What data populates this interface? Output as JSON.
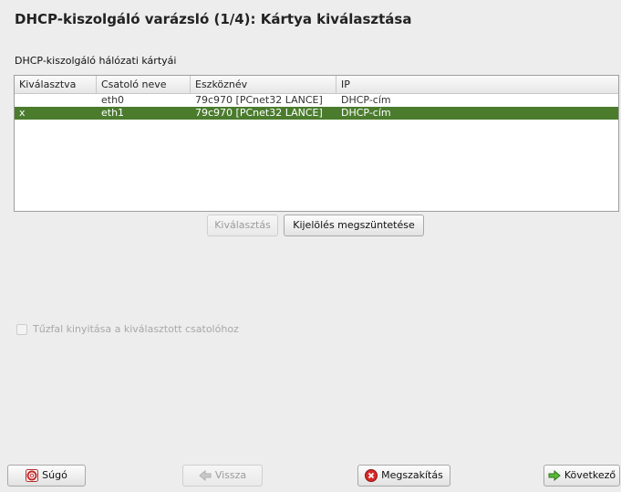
{
  "window": {
    "title": "DHCP-kiszolgáló varázsló (1/4): Kártya kiválasztása"
  },
  "cards": {
    "label": "DHCP-kiszolgáló hálózati kártyái",
    "columns": [
      "Kiválasztva",
      "Csatoló neve",
      "Eszköznév",
      "IP"
    ],
    "rows": [
      {
        "selected": "",
        "iface": "eth0",
        "device": "79c970 [PCnet32 LANCE]",
        "ip": "DHCP-cím"
      },
      {
        "selected": "x",
        "iface": "eth1",
        "device": "79c970 [PCnet32 LANCE]",
        "ip": "DHCP-cím"
      }
    ],
    "selected_row_color": "#4b7c2e"
  },
  "actions": {
    "select_label": "Kiválasztás",
    "deselect_label": "Kijelölés megszüntetése"
  },
  "firewall": {
    "label": "Tűzfal kinyitása a kiválasztott csatolóhoz",
    "checked": false
  },
  "footer": {
    "help_label": "Súgó",
    "back_label": "Vissza",
    "abort_label": "Megszakítás",
    "next_label": "Következő"
  },
  "icons": {
    "help": "lifebuoy-icon",
    "back": "arrow-left-icon",
    "abort": "stop-icon",
    "next": "arrow-right-icon"
  }
}
